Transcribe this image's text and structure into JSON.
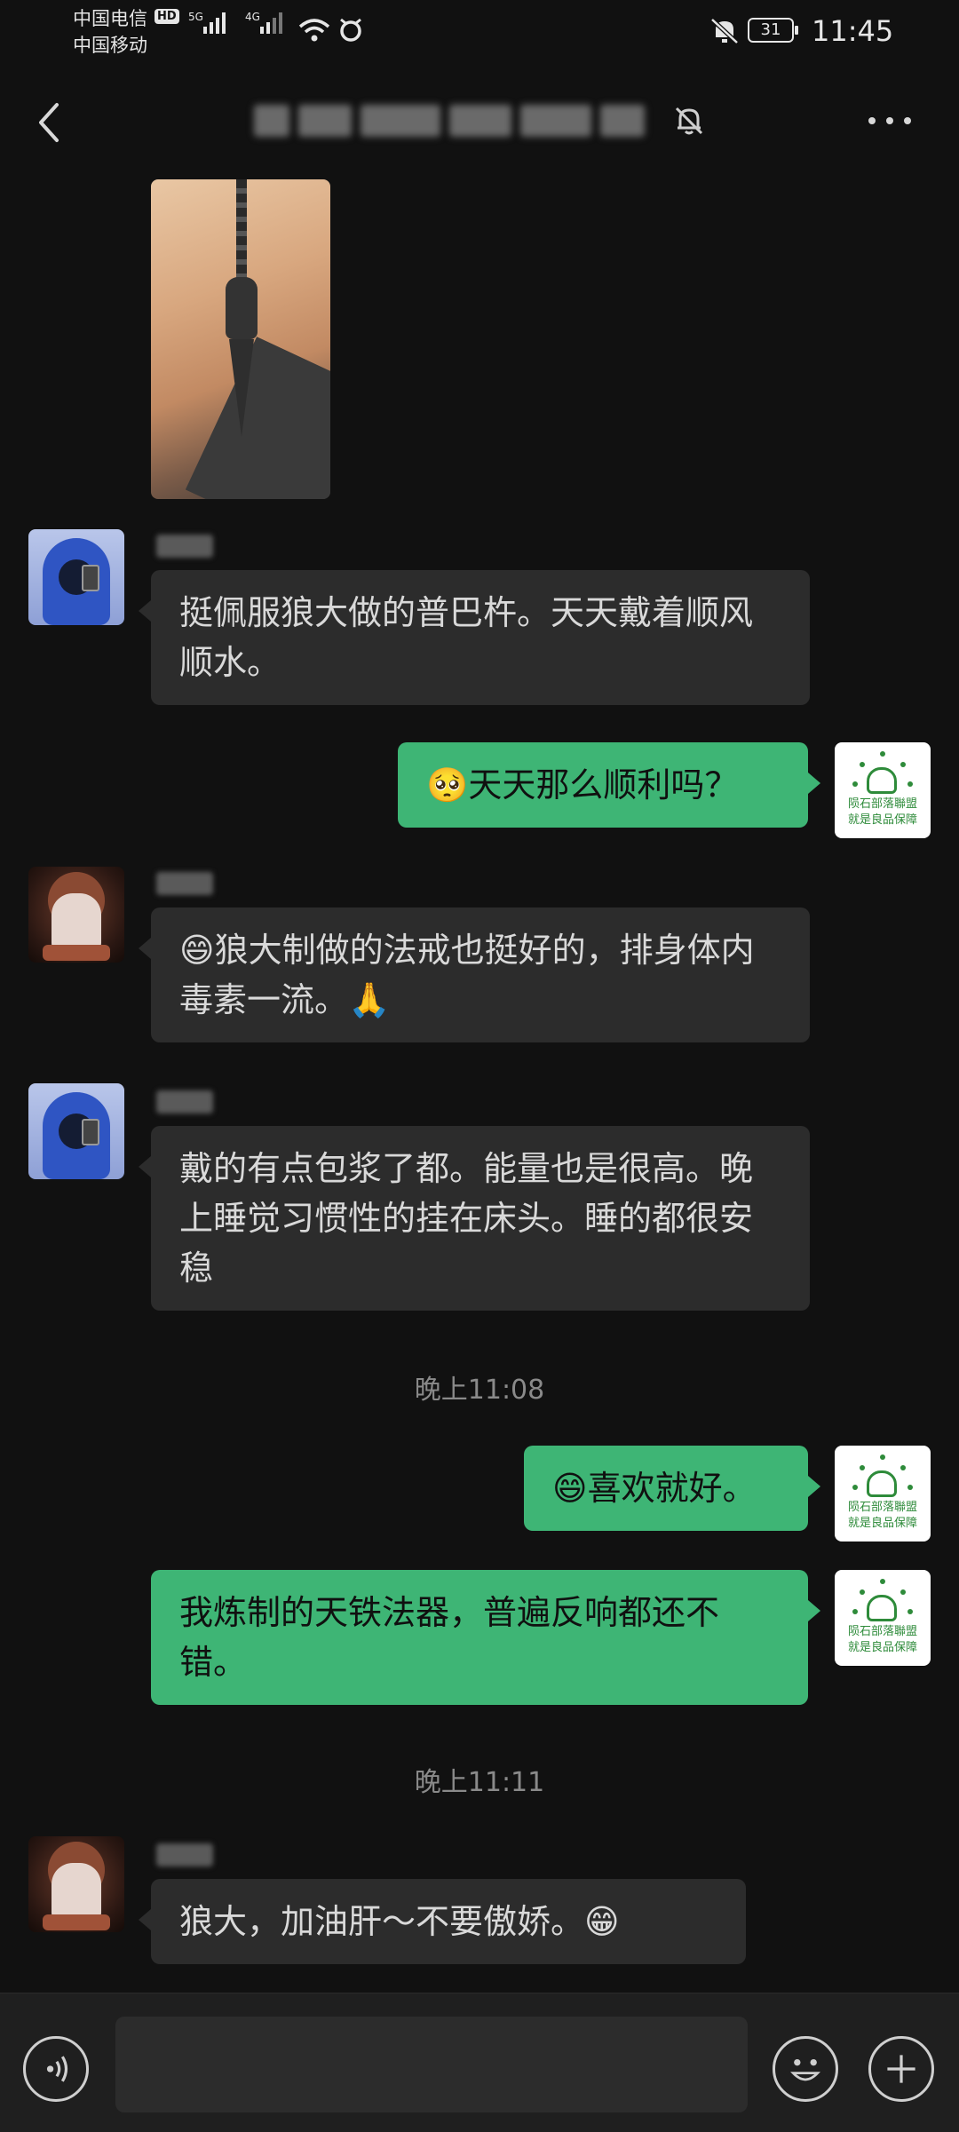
{
  "status_bar": {
    "carrier_1": "中国电信",
    "carrier_1_badge": "HD",
    "carrier_2": "中国移动",
    "signal_1_label": "5G",
    "signal_2_label": "4G",
    "battery_level": "31",
    "time": "11:45"
  },
  "nav": {
    "back_icon": "chevron-left-icon",
    "mute_icon": "bell-off-icon",
    "more_icon": "more-dots-icon"
  },
  "messages": [
    {
      "direction": "in",
      "type": "image"
    },
    {
      "direction": "in",
      "avatar": "hooded-avatar",
      "text": "挺佩服狼大做的普巴杵。天天戴着顺风顺水。"
    },
    {
      "direction": "out",
      "text": "🥺天天那么顺利吗？"
    },
    {
      "direction": "in",
      "avatar": "buddha-avatar",
      "text": "😄狼大制做的法戒也挺好的，排身体内毒素一流。🙏"
    },
    {
      "direction": "in",
      "avatar": "hooded-avatar",
      "text": "戴的有点包浆了都。能量也是很高。晚上睡觉习惯性的挂在床头。睡的都很安稳"
    },
    {
      "type": "timestamp",
      "text": "晚上11:08"
    },
    {
      "direction": "out",
      "text": "😄喜欢就好。"
    },
    {
      "direction": "out",
      "text": "我炼制的天铁法器，普遍反响都还不错。"
    },
    {
      "type": "timestamp",
      "text": "晚上11:11"
    },
    {
      "direction": "in",
      "avatar": "buddha-avatar",
      "text": "狼大，加油肝～不要傲娇。😁"
    }
  ],
  "self_avatar": {
    "line_1": "陨石部落聯盟",
    "line_2": "就是良品保障"
  },
  "input_bar": {
    "text": "",
    "voice_icon": "voice-icon",
    "emoji_icon": "emoji-icon",
    "plus_icon": "plus-icon"
  },
  "colors": {
    "background": "#111111",
    "incoming_bubble": "#2c2c2c",
    "outgoing_bubble": "#3eb575",
    "timestamp": "#8a8a8a"
  }
}
